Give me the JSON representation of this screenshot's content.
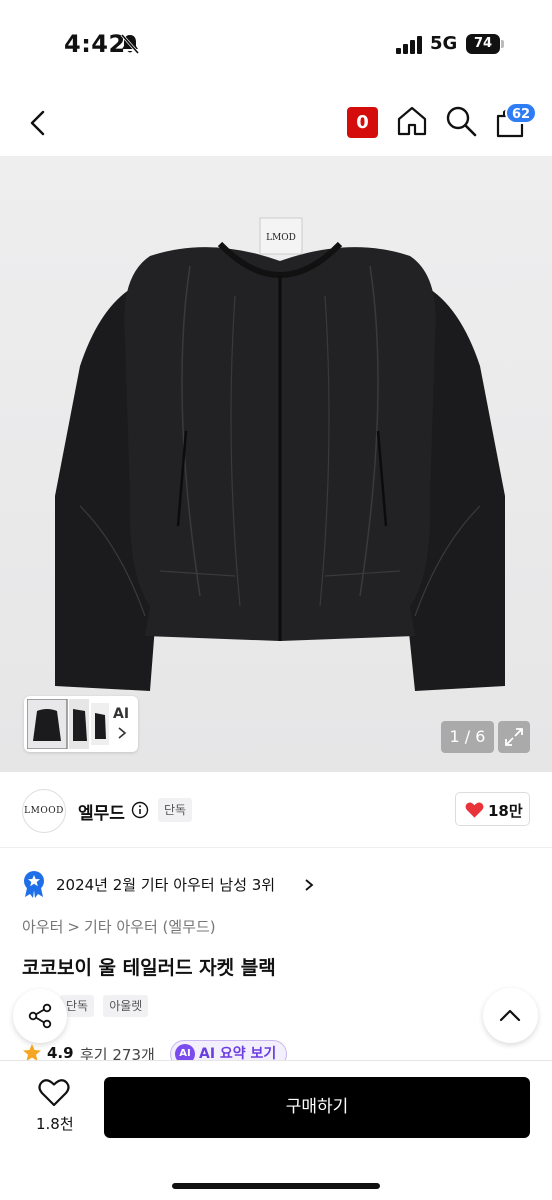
{
  "status_bar": {
    "time": "4:42",
    "network": "5G",
    "battery": "74"
  },
  "header": {
    "badge_zero": "0",
    "cart_count": "62"
  },
  "gallery": {
    "counter": "1 / 6",
    "thumb_ai": "AI"
  },
  "brand": {
    "logo_text": "LMOOD",
    "name": "엘무드",
    "exclusive": "단독",
    "like_count": "18만"
  },
  "ranking": {
    "text": "2024년 2월 기타 아우터 남성 3위"
  },
  "breadcrumb": [
    "아우터",
    "기타 아우터 (엘무드)"
  ],
  "product": {
    "title": "코코보이 울 테일러드 자켓 블랙",
    "tags": [
      "단독",
      "아울렛"
    ],
    "rating": "4.9",
    "reviews": "후기 273개",
    "ai_badge": "AI",
    "ai_summary": "AI 요약 보기"
  },
  "bottom_bar": {
    "wishlist_count": "1.8천",
    "buy_label": "구매하기"
  },
  "colors": {
    "badge_red": "#d40c0c",
    "cart_blue": "#2f7df5",
    "heart_red": "#e8333a",
    "star_orange": "#f5a623",
    "ai_purple": "#7a4cf0",
    "buy_black": "#000000"
  }
}
